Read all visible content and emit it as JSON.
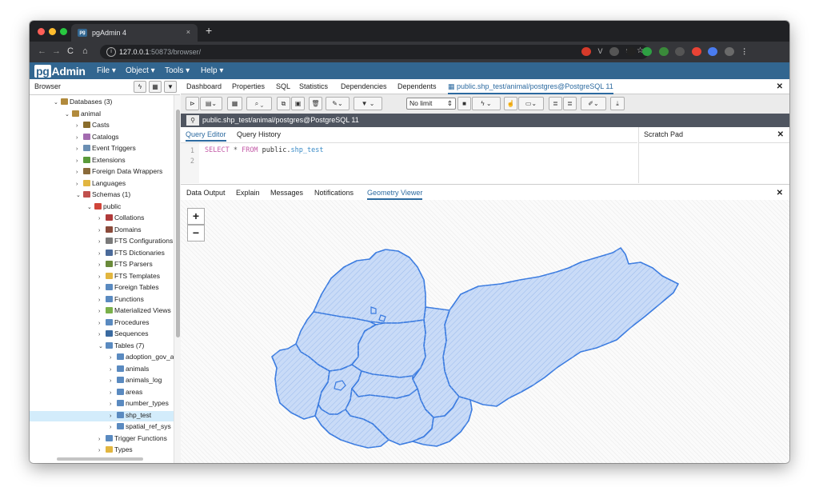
{
  "chrome": {
    "tab_title": "pgAdmin 4",
    "tab_favicon": "pg",
    "tab_close": "×",
    "new_tab": "+",
    "url_host": "127.0.0.1",
    "url_path": ":50873/browser/"
  },
  "app": {
    "logo_prefix": "pg",
    "logo_suffix": "Admin",
    "menu": [
      "File ▾",
      "Object ▾",
      "Tools ▾",
      "Help ▾"
    ]
  },
  "browser": {
    "title": "Browser",
    "tree": [
      {
        "label": "Databases (3)",
        "caret": "⌄",
        "icon": "database-icon",
        "color": "#b18a3c"
      },
      {
        "label": "animal",
        "caret": "⌄",
        "icon": "database-icon",
        "color": "#b18a3c"
      },
      {
        "label": "Casts",
        "caret": "›",
        "icon": "casts-icon",
        "color": "#8a6d2c"
      },
      {
        "label": "Catalogs",
        "caret": "›",
        "icon": "catalogs-icon",
        "color": "#a36bb0"
      },
      {
        "label": "Event Triggers",
        "caret": "›",
        "icon": "event-trigger-icon",
        "color": "#6b8fb3"
      },
      {
        "label": "Extensions",
        "caret": "›",
        "icon": "extensions-icon",
        "color": "#5a9a3a"
      },
      {
        "label": "Foreign Data Wrappers",
        "caret": "›",
        "icon": "fdw-icon",
        "color": "#8a6a3a"
      },
      {
        "label": "Languages",
        "caret": "›",
        "icon": "languages-icon",
        "color": "#e2b640"
      },
      {
        "label": "Schemas (1)",
        "caret": "⌄",
        "icon": "schemas-icon",
        "color": "#c0504d"
      },
      {
        "label": "public",
        "caret": "⌄",
        "icon": "schema-icon",
        "color": "#d0453a"
      },
      {
        "label": "Collations",
        "caret": "›",
        "icon": "collations-icon",
        "color": "#b03a3a"
      },
      {
        "label": "Domains",
        "caret": "›",
        "icon": "domains-icon",
        "color": "#8a4a3a"
      },
      {
        "label": "FTS Configurations",
        "caret": "›",
        "icon": "fts-config-icon",
        "color": "#7a7a7a"
      },
      {
        "label": "FTS Dictionaries",
        "caret": "›",
        "icon": "fts-dict-icon",
        "color": "#4a6a9a"
      },
      {
        "label": "FTS Parsers",
        "caret": "›",
        "icon": "fts-parser-icon",
        "color": "#6a8a3a"
      },
      {
        "label": "FTS Templates",
        "caret": "›",
        "icon": "fts-template-icon",
        "color": "#e2b640"
      },
      {
        "label": "Foreign Tables",
        "caret": "›",
        "icon": "foreign-table-icon",
        "color": "#5a8ac0"
      },
      {
        "label": "Functions",
        "caret": "›",
        "icon": "functions-icon",
        "color": "#5a8ac0"
      },
      {
        "label": "Materialized Views",
        "caret": "›",
        "icon": "matview-icon",
        "color": "#7ab04a"
      },
      {
        "label": "Procedures",
        "caret": "›",
        "icon": "procedures-icon",
        "color": "#5a8ac0"
      },
      {
        "label": "Sequences",
        "caret": "›",
        "icon": "sequences-icon",
        "color": "#3a6aa0"
      },
      {
        "label": "Tables (7)",
        "caret": "⌄",
        "icon": "tables-icon",
        "color": "#5a8ac0"
      },
      {
        "label": "adoption_gov_a",
        "caret": "›",
        "icon": "table-icon",
        "color": "#5a8ac0"
      },
      {
        "label": "animals",
        "caret": "›",
        "icon": "table-icon",
        "color": "#5a8ac0"
      },
      {
        "label": "animals_log",
        "caret": "›",
        "icon": "table-icon",
        "color": "#5a8ac0"
      },
      {
        "label": "areas",
        "caret": "›",
        "icon": "table-icon",
        "color": "#5a8ac0"
      },
      {
        "label": "number_types",
        "caret": "›",
        "icon": "table-icon",
        "color": "#5a8ac0"
      },
      {
        "label": "shp_test",
        "caret": "›",
        "icon": "table-icon",
        "color": "#5a8ac0"
      },
      {
        "label": "spatial_ref_sys",
        "caret": "›",
        "icon": "table-icon",
        "color": "#5a8ac0"
      },
      {
        "label": "Trigger Functions",
        "caret": "›",
        "icon": "trigger-function-icon",
        "color": "#5a8ac0"
      },
      {
        "label": "Types",
        "caret": "›",
        "icon": "types-icon",
        "color": "#e2b640"
      }
    ],
    "selected": "shp_test"
  },
  "panel_tabs": [
    "Dashboard",
    "Properties",
    "SQL",
    "Statistics",
    "Dependencies",
    "Dependents"
  ],
  "active_tab": "public.shp_test/animal/postgres@PostgreSQL 11",
  "toolbar": {
    "limit": "No limit"
  },
  "connection": "public.shp_test/animal/postgres@PostgreSQL 11",
  "query_tabs": [
    "Query Editor",
    "Query History"
  ],
  "scratch_pad": "Scratch Pad",
  "editor": {
    "line_numbers": [
      "1",
      "2"
    ],
    "kw_select": "SELECT",
    "star": " * ",
    "kw_from": "FROM",
    "schema": " public.",
    "table": "shp_test"
  },
  "output_tabs": [
    "Data Output",
    "Explain",
    "Messages",
    "Notifications",
    "Geometry Viewer"
  ],
  "output_active": "Geometry Viewer",
  "zoom": {
    "in": "+",
    "out": "−"
  },
  "close": "✕",
  "colors": {
    "accent": "#326690",
    "polygon_fill": "#c7d9f7",
    "polygon_stroke": "#3a7be0",
    "selection": "#d3ecfb"
  }
}
